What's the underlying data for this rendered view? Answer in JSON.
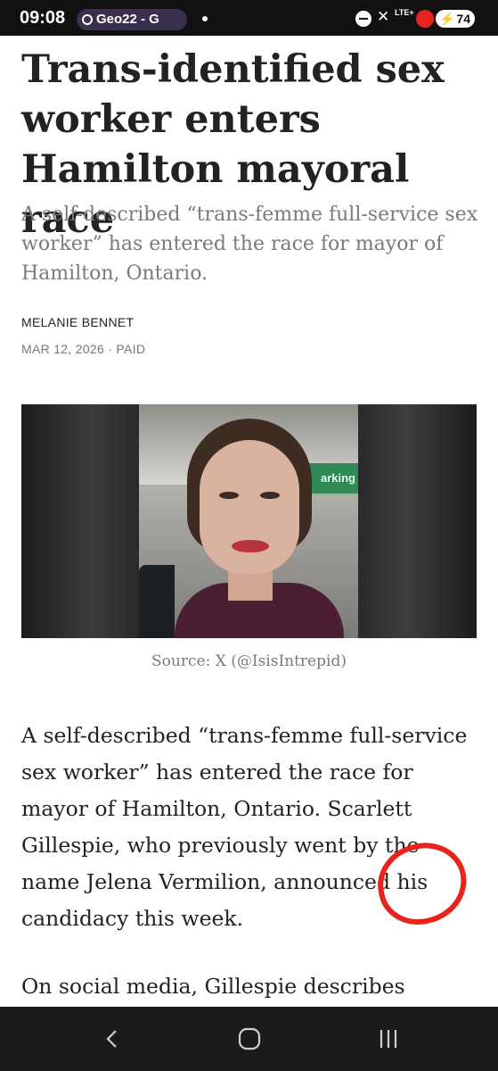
{
  "status_bar": {
    "time": "09:08",
    "pill_label": "Geo22 - G",
    "network": "LTE+",
    "battery": "74"
  },
  "article": {
    "title": "Trans-identified sex worker enters Hamilton mayoral race",
    "subtitle": "A self-described “trans-femme full-service sex worker” has entered the race for mayor of Hamilton, Ontario.",
    "author": "MELANIE BENNET",
    "date_line": "MAR 12, 2026 · PAID",
    "image_caption": "Source: X (@IsisIntrepid)",
    "sign_text": "arking",
    "paragraph_1": "A self-described “trans-femme full-service sex worker” has entered the race for mayor of Hamilton, Ontario. Scarlett Gillespie, who previously went by the name Jelena Vermilion, announced his candidacy this week.",
    "paragraph_2": "On social media, Gillespie describes"
  },
  "annotation": {
    "color": "#e8241c",
    "shape": "hand-drawn-circle"
  },
  "nav_bar": {
    "icons": [
      "back-icon",
      "home-icon",
      "recent-apps-icon"
    ]
  },
  "colors": {
    "status_bar_bg": "#111111",
    "nav_bar_bg": "#1b1b1d",
    "subtitle_text": "#7a7a7a"
  }
}
